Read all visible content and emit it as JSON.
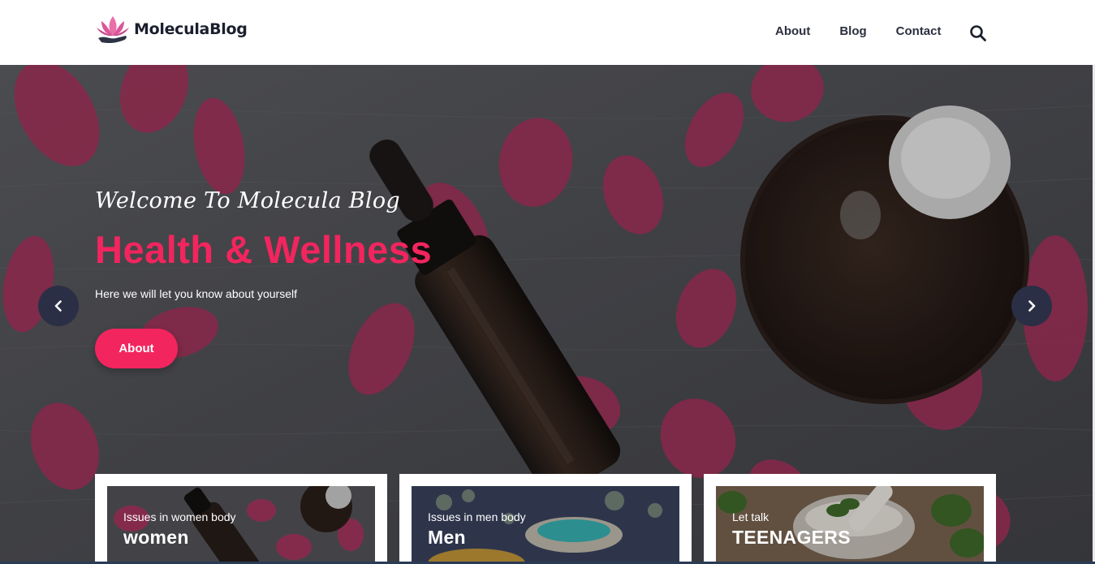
{
  "brand": {
    "name": "MoleculaBlog"
  },
  "nav": {
    "items": [
      "About",
      "Blog",
      "Contact"
    ]
  },
  "hero": {
    "welcome": "Welcome To Molecula Blog",
    "title": "Health & Wellness",
    "subtitle": "Here we will let you know about yourself",
    "button_label": "About"
  },
  "cards": [
    {
      "kicker": "Issues in women body",
      "title": "women"
    },
    {
      "kicker": "Issues in men body",
      "title": "Men"
    },
    {
      "kicker": "Let talk",
      "title": "TEENAGERS"
    }
  ],
  "colors": {
    "accent": "#f2255e",
    "dark": "#2a2f45"
  },
  "icons": {
    "search": "search-icon",
    "prev": "chevron-left-icon",
    "next": "chevron-right-icon",
    "logo": "lotus-icon"
  }
}
